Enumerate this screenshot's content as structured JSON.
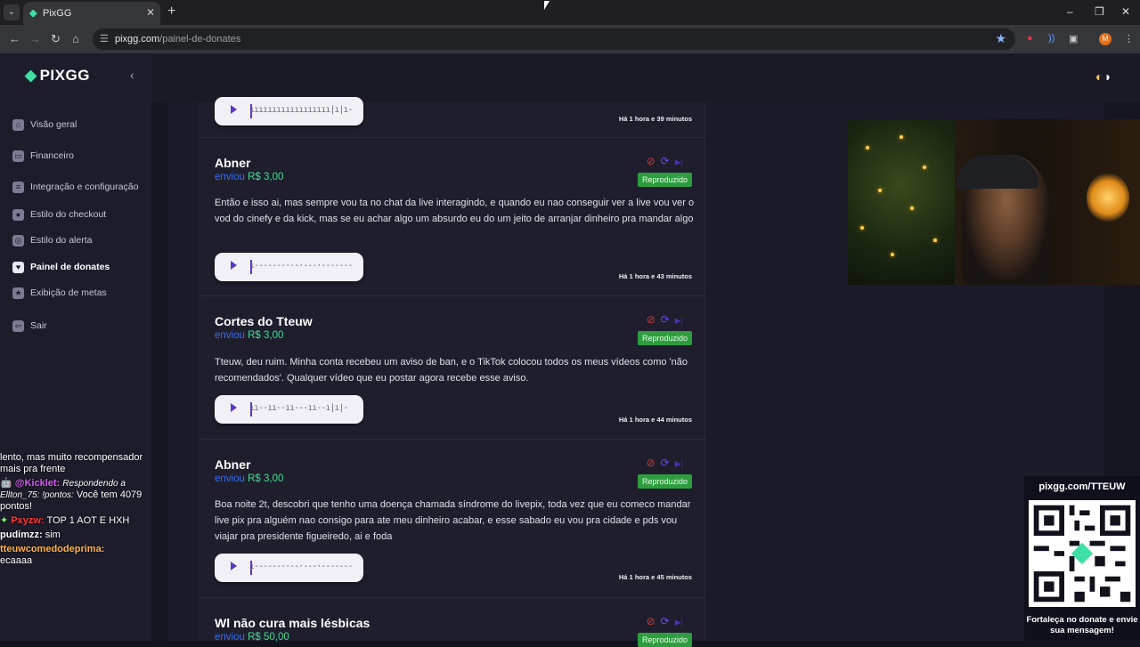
{
  "browser": {
    "tab_title": "PixGG",
    "tab_close": "✕",
    "new_tab": "+",
    "url_host": "pixgg.com",
    "url_path": "/painel-de-donates",
    "win_minimize": "–",
    "win_restore": "❐",
    "win_close": "✕",
    "profile_initial": "M"
  },
  "sidebar": {
    "logo": "PIXGG",
    "items": [
      {
        "label": "Visão geral",
        "icon": "home-icon"
      },
      {
        "label": "Financeiro",
        "icon": "wallet-icon"
      },
      {
        "label": "Integração e configuração",
        "icon": "settings-icon"
      },
      {
        "label": "Estilo do checkout",
        "icon": "palette-icon"
      },
      {
        "label": "Estilo do alerta",
        "icon": "bell-icon"
      },
      {
        "label": "Painel de donates",
        "icon": "donate-icon"
      },
      {
        "label": "Exibição de metas",
        "icon": "star-icon"
      },
      {
        "label": "Sair",
        "icon": "logout-icon"
      }
    ],
    "active_index": 5
  },
  "feed": {
    "top_card_time": "Há 1 hora e 39 minutos",
    "donations": [
      {
        "name": "Abner",
        "verb": "enviou",
        "amount": "R$ 3,00",
        "status": "Reproduzido",
        "message": "Então e isso ai, mas sempre vou ta no chat da live interagindo, e quando eu nao conseguir ver a live vou ver o vod do cinefy e da kick, mas se eu achar algo um absurdo eu do um jeito de arranjar dinheiro pra mandar algo",
        "time": "Há 1 hora e 43 minutos"
      },
      {
        "name": "Cortes do Tteuw",
        "verb": "enviou",
        "amount": "R$ 3,00",
        "status": "Reproduzido",
        "message": "Tteuw, deu ruim. Minha conta recebeu um aviso de ban, e o TikTok colocou todos os meus vídeos como 'não recomendados'. Qualquer vídeo que eu postar agora recebe esse aviso.",
        "time": "Há 1 hora e 44 minutos"
      },
      {
        "name": "Abner",
        "verb": "enviou",
        "amount": "R$ 3,00",
        "status": "Reproduzido",
        "message": "Boa noite 2t, descobri que tenho uma doença chamada síndrome do livepix, toda vez que eu comeco mandar live pix pra alguém nao consigo para ate meu dinheiro acabar, e esse sabado eu vou pra cidade e pds vou viajar pra presidente figueiredo, ai e foda",
        "time": "Há 1 hora e 45 minutos"
      },
      {
        "name": "Wl não cura mais lésbicas",
        "verb": "enviou",
        "amount": "R$ 50,00",
        "status": "Reproduzido",
        "message": "",
        "time": ""
      }
    ]
  },
  "chat": {
    "line1": "lento, mas muito recompensador mais pra frente",
    "u1": "@Kicklet:",
    "reply": "Respondendo a Ellton_75: !pontos:",
    "msg1": "Você tem 4079 pontos!",
    "u2": "Pxyzw:",
    "msg2": "TOP 1 AOT E HXH",
    "u3": "pudimzz:",
    "msg3": "sim",
    "u4": "tteuwcomedodeprima:",
    "msg4": "ecaaaa"
  },
  "qr": {
    "title": "pixgg.com/TTEUW",
    "caption": "Fortaleça no donate e envie sua mensagem!"
  },
  "colors": {
    "accent_green": "#3ee0a6",
    "amount_green": "#3ee08f",
    "verb_blue": "#3b6ef0",
    "badge_green": "#2e9d3f",
    "ban_red": "#d03a3a",
    "replay_purple": "#6b49f0"
  }
}
